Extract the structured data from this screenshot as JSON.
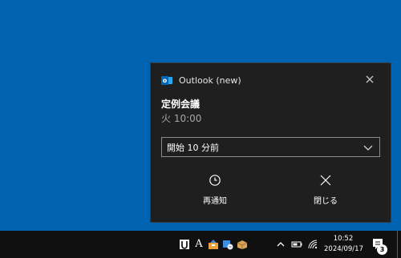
{
  "notification": {
    "app_name": "Outlook (new)",
    "app_icon": "outlook-icon",
    "title": "定例会議",
    "subtitle": "火 10:00",
    "snooze_select": {
      "selected": "開始 10 分前"
    },
    "actions": [
      {
        "label": "再通知",
        "icon": "clock-icon"
      },
      {
        "label": "閉じる",
        "icon": "close-icon"
      }
    ]
  },
  "taskbar": {
    "ime_label": "A",
    "time": "10:52",
    "date": "2024/09/17",
    "notification_count": "3"
  },
  "colors": {
    "desktop": "#0063b1",
    "toast_bg": "#1f1f1f",
    "taskbar_bg": "#101010"
  }
}
